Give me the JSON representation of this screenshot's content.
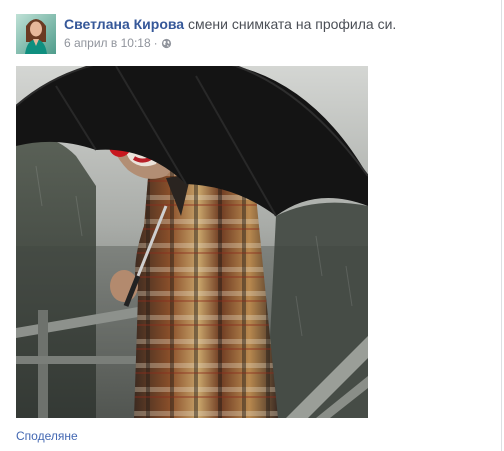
{
  "post": {
    "author": "Светлана Кирова",
    "action": "смени снимката на профила си.",
    "timestamp": "6 април в 10:18",
    "separator": "·",
    "audience_icon": "globe-icon"
  },
  "actions": {
    "share_label": "Споделяне"
  },
  "colors": {
    "author_link": "#365899",
    "meta_text": "#90949c",
    "share_link": "#4267b2"
  }
}
